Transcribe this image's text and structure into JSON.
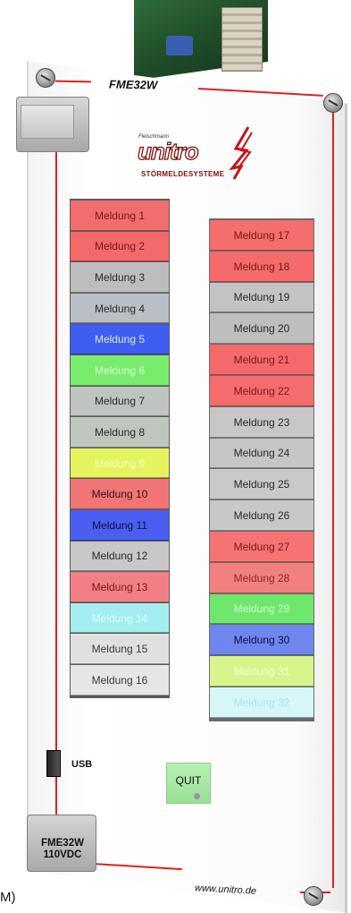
{
  "device": {
    "model_top": "FME32W",
    "handle_label_line1": "FME32W",
    "handle_label_line2": "110VDC",
    "url": "www.unitro.de",
    "usb_label": "USB",
    "quit_label": "QUIT",
    "caption": "M)"
  },
  "logo": {
    "small": "Fleischmann",
    "main": "unitro",
    "sub": "STÖRMELDESYSTEME",
    "color": "#7a1010"
  },
  "messages_left": [
    {
      "label": "Meldung 1",
      "bg": "#f26d6d",
      "fg": "#7a1a1a"
    },
    {
      "label": "Meldung 2",
      "bg": "#f46a6a",
      "fg": "#7a1a1a"
    },
    {
      "label": "Meldung 3",
      "bg": "#bdbdbd",
      "fg": "#2a2a2a"
    },
    {
      "label": "Meldung 4",
      "bg": "#b9bfc5",
      "fg": "#2a2a2a"
    },
    {
      "label": "Meldung 5",
      "bg": "#3f5df0",
      "fg": "#dfe6ff"
    },
    {
      "label": "Meldung 6",
      "bg": "#79ec6e",
      "fg": "#d9ffd3"
    },
    {
      "label": "Meldung 7",
      "bg": "#c0c4c0",
      "fg": "#2a2a2a"
    },
    {
      "label": "Meldung 8",
      "bg": "#bfc6bd",
      "fg": "#2a2a2a"
    },
    {
      "label": "Meldung 9",
      "bg": "#e5f45e",
      "fg": "#f7ffc4"
    },
    {
      "label": "Meldung 10",
      "bg": "#f27575",
      "fg": "#3a1010"
    },
    {
      "label": "Meldung 11",
      "bg": "#4b5ef2",
      "fg": "#0a1040"
    },
    {
      "label": "Meldung 12",
      "bg": "#c8c8c8",
      "fg": "#2a2a2a"
    },
    {
      "label": "Meldung 13",
      "bg": "#f37f86",
      "fg": "#7a1a1a"
    },
    {
      "label": "Meldung 14",
      "bg": "#a4eef0",
      "fg": "#d8ffff"
    },
    {
      "label": "Meldung 15",
      "bg": "#e0e0e0",
      "fg": "#3a3a3a"
    },
    {
      "label": "Meldung 16",
      "bg": "#e6e6e6",
      "fg": "#3a3a3a"
    }
  ],
  "messages_right": [
    {
      "label": "Meldung 17",
      "bg": "#f46e6e",
      "fg": "#7a1a1a"
    },
    {
      "label": "Meldung 18",
      "bg": "#f56b6b",
      "fg": "#7a1a1a"
    },
    {
      "label": "Meldung 19",
      "bg": "#c3c3c3",
      "fg": "#2a2a2a"
    },
    {
      "label": "Meldung 20",
      "bg": "#bebebe",
      "fg": "#2a2a2a"
    },
    {
      "label": "Meldung 21",
      "bg": "#f46a6a",
      "fg": "#7a1a1a"
    },
    {
      "label": "Meldung 22",
      "bg": "#f56c6c",
      "fg": "#7a1a1a"
    },
    {
      "label": "Meldung 23",
      "bg": "#c7c7c7",
      "fg": "#2a2a2a"
    },
    {
      "label": "Meldung 24",
      "bg": "#c6c6c6",
      "fg": "#2a2a2a"
    },
    {
      "label": "Meldung 25",
      "bg": "#c9c9c9",
      "fg": "#2a2a2a"
    },
    {
      "label": "Meldung 26",
      "bg": "#c8c8c8",
      "fg": "#2a2a2a"
    },
    {
      "label": "Meldung 27",
      "bg": "#f57373",
      "fg": "#7a1a1a"
    },
    {
      "label": "Meldung 28",
      "bg": "#f38080",
      "fg": "#8a2a2a"
    },
    {
      "label": "Meldung 29",
      "bg": "#6ee86c",
      "fg": "#d2ffd0"
    },
    {
      "label": "Meldung 30",
      "bg": "#6f86ee",
      "fg": "#0a1040"
    },
    {
      "label": "Meldung 31",
      "bg": "#d8f58c",
      "fg": "#f2ffd8"
    },
    {
      "label": "Meldung 32",
      "bg": "#d6f6f8",
      "fg": "#a7e8ee"
    }
  ]
}
